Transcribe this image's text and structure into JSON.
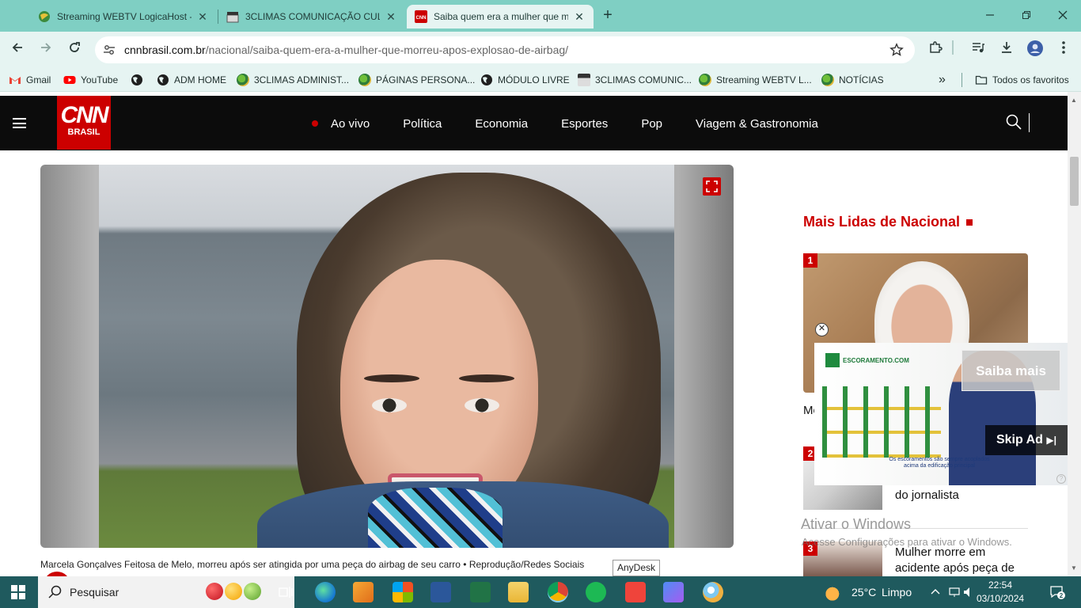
{
  "browser": {
    "tabs": [
      {
        "title": "Streaming WEBTV LogicaHost -",
        "active": false
      },
      {
        "title": "3CLIMAS COMUNICAÇÃO CULT",
        "active": false
      },
      {
        "title": "Saiba quem era a mulher que m",
        "active": true
      }
    ],
    "close_glyph": "✕",
    "new_tab_glyph": "+",
    "address": {
      "domain": "cnnbrasil.com.br",
      "path": "/nacional/saiba-quem-era-a-mulher-que-morreu-apos-explosao-de-airbag/"
    },
    "bookmarks": [
      {
        "label": "Gmail",
        "icon": "gmail-icon"
      },
      {
        "label": "YouTube",
        "icon": "youtube-icon"
      },
      {
        "label": "",
        "icon": "globe-icon"
      },
      {
        "label": "ADM HOME",
        "icon": "globe-icon"
      },
      {
        "label": "3CLIMAS ADMINIST...",
        "icon": "globe-color-icon"
      },
      {
        "label": "PÁGINAS PERSONA...",
        "icon": "globe-color-icon"
      },
      {
        "label": "MÓDULO LIVRE",
        "icon": "globe-icon"
      },
      {
        "label": "3CLIMAS COMUNIC...",
        "icon": "clapper-icon"
      },
      {
        "label": "Streaming WEBTV L...",
        "icon": "globe-color-icon"
      },
      {
        "label": "NOTÍCIAS",
        "icon": "globe-color-icon"
      }
    ],
    "bookmarks_more": "»",
    "all_bookmarks": "Todos os favoritos"
  },
  "site": {
    "logo_top": "CNN",
    "logo_bottom": "BRASIL",
    "nav": [
      "Ao vivo",
      "Política",
      "Economia",
      "Esportes",
      "Pop",
      "Viagem & Gastronomia"
    ],
    "caption": "Marcela Gonçalves Feitosa de Melo, morreu após ser atingida por uma peça do airbag de seu carro • Reprodução/Redes Sociais",
    "sidebar": {
      "title": "Mais Lidas de Nacional",
      "items": [
        {
          "rank": "1",
          "headline_fragment": "Mo"
        },
        {
          "rank": "2",
          "headline_fragment": "do jornalista"
        },
        {
          "rank": "3",
          "headline_line1": "Mulher morre em",
          "headline_line2": "acidente após peça de"
        }
      ]
    }
  },
  "ad": {
    "brand": "ESCORAMENTO.COM",
    "slogan": "Os escoramentos são sempre acoplados acima da edificação principal",
    "cta": "Saiba mais",
    "skip": "Skip Ad",
    "skip_glyph": "▶|",
    "close_glyph": "✕",
    "info_glyph": "?"
  },
  "overlay": {
    "activate_title": "Ativar o Windows",
    "activate_sub": "Acesse Configurações para ativar o Windows.",
    "tooltip": "AnyDesk"
  },
  "taskbar": {
    "search_placeholder": "Pesquisar",
    "weather_temp": "25°C",
    "weather_text": "Limpo",
    "time": "22:54",
    "date": "03/10/2024",
    "notification_count": "2"
  }
}
